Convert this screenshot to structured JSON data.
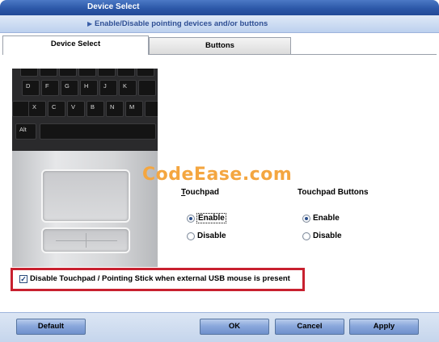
{
  "window": {
    "title": "Device Select",
    "subtitle": "Enable/Disable pointing devices and/or buttons"
  },
  "tabs": [
    {
      "label": "Device Select",
      "active": true
    },
    {
      "label": "Buttons",
      "active": false
    }
  ],
  "keyboard": {
    "row1": [
      "D",
      "F",
      "G",
      "H",
      "J",
      "K"
    ],
    "row2": [
      "X",
      "C",
      "V",
      "B",
      "N",
      "M"
    ],
    "row3": [
      "Alt"
    ]
  },
  "touchpad_group": {
    "label": "Touchpad",
    "options": [
      {
        "label": "Enable",
        "selected": true
      },
      {
        "label": "Disable",
        "selected": false
      }
    ]
  },
  "buttons_group": {
    "label": "Touchpad Buttons",
    "options": [
      {
        "label": "Enable",
        "selected": true
      },
      {
        "label": "Disable",
        "selected": false
      }
    ]
  },
  "usb_checkbox": {
    "label": "Disable Touchpad / Pointing Stick when external USB mouse is present",
    "checked": true,
    "highlight_color": "#c8202f"
  },
  "watermark": "CodeEase.com",
  "footer": {
    "default_label": "Default",
    "ok_label": "OK",
    "cancel_label": "Cancel",
    "apply_label": "Apply"
  },
  "colors": {
    "titlebar": "#2c58a8",
    "banner": "#c8d8f0",
    "watermark": "#f4a640"
  }
}
